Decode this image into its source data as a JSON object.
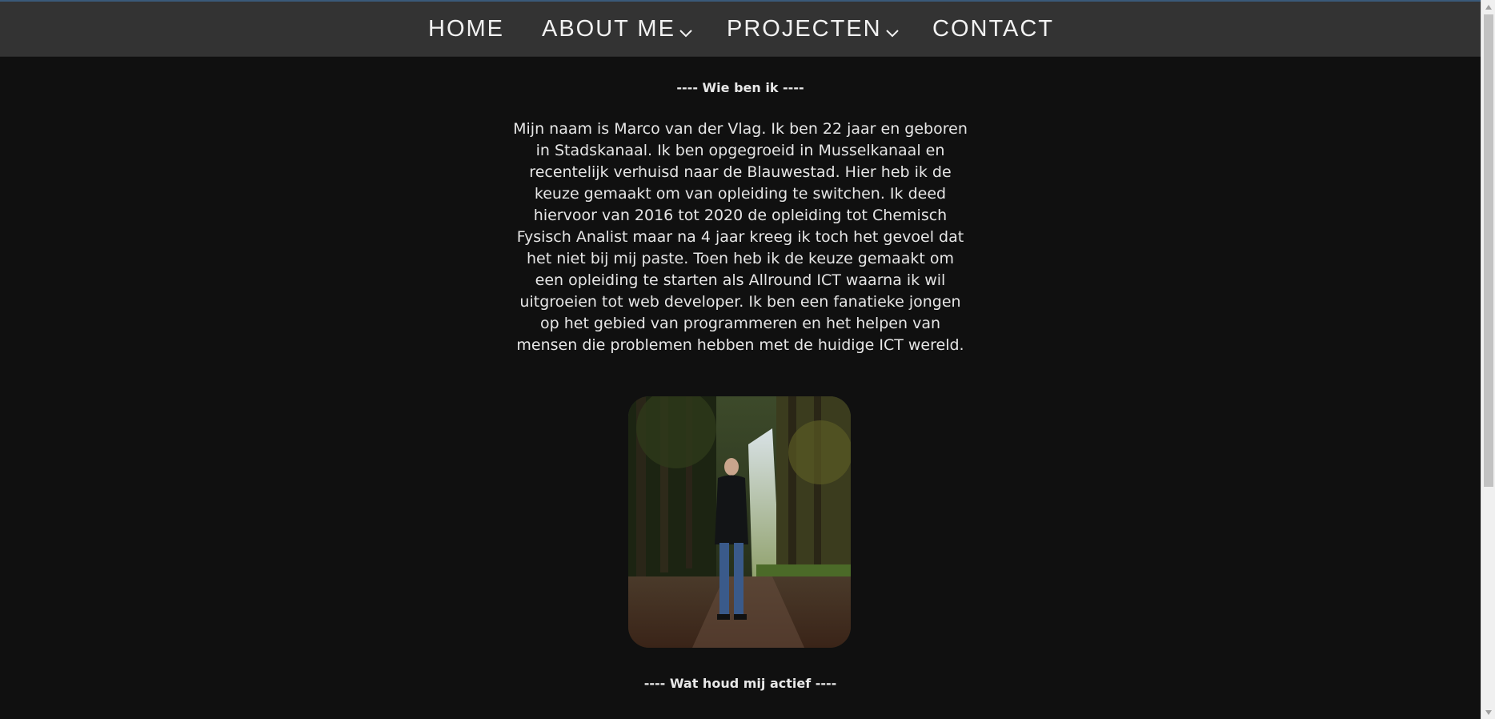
{
  "nav": {
    "home": "HOME",
    "about": "ABOUT ME",
    "projecten": "PROJECTEN",
    "contact": "CONTACT"
  },
  "about": {
    "heading": "---- Wie ben ik ----",
    "text": "Mijn naam is Marco van der Vlag. Ik ben 22 jaar en geboren in Stadskanaal. Ik ben opgegroeid in Musselkanaal en recentelijk verhuisd naar de Blauwestad. Hier heb ik de keuze gemaakt om van opleiding te switchen. Ik deed hiervoor van 2016 tot 2020 de opleiding tot Chemisch Fysisch Analist maar na 4 jaar kreeg ik toch het gevoel dat het niet bij mij paste. Toen heb ik de keuze gemaakt om een opleiding te starten als Allround ICT waarna ik wil uitgroeien tot web developer. Ik ben een fanatieke jongen op het gebied van programmeren en het helpen van mensen die problemen hebben met de huidige ICT wereld."
  },
  "activities": {
    "heading": "---- Wat houd mij actief ----"
  },
  "icons": {
    "about_dropdown": "chevron-down-icon",
    "projecten_dropdown": "chevron-down-icon"
  },
  "colors": {
    "background": "#101010",
    "navbar": "#333333",
    "text": "#e6e6e6"
  }
}
